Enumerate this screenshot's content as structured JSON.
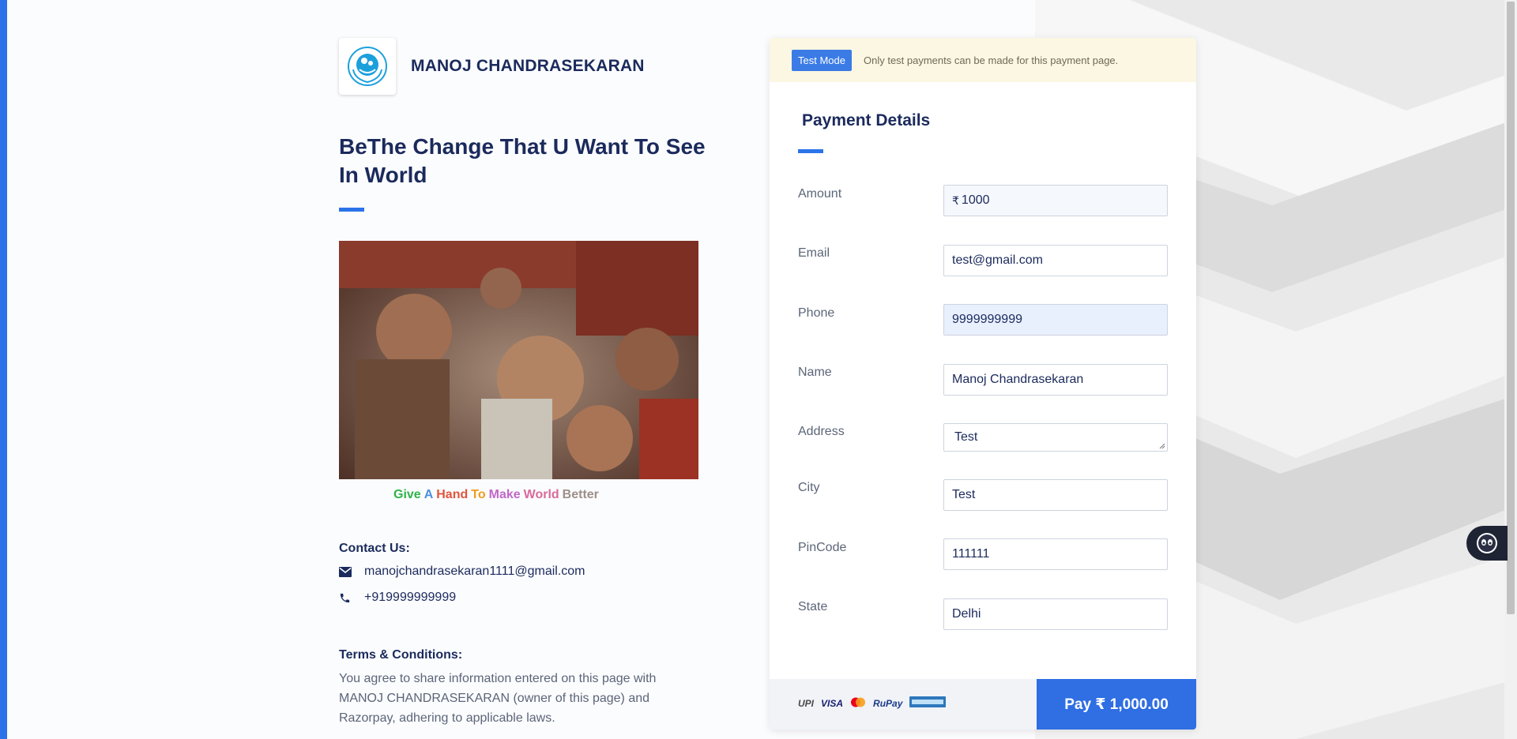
{
  "merchant": {
    "name": "MANOJ CHANDRASEKARAN"
  },
  "headline": "BeThe Change That U Want To See In World",
  "caption": [
    {
      "text": "Give",
      "color": "#2fb34a"
    },
    {
      "text": "A",
      "color": "#4a8fe0"
    },
    {
      "text": "Hand",
      "color": "#e2553c"
    },
    {
      "text": "To",
      "color": "#f29c1f"
    },
    {
      "text": "Make",
      "color": "#c067c8"
    },
    {
      "text": "World",
      "color": "#d96a9a"
    },
    {
      "text": "Better",
      "color": "#9e8f8a"
    }
  ],
  "contact": {
    "title": "Contact Us:",
    "email": "manojchandrasekaran1111@gmail.com",
    "phone": "+919999999999"
  },
  "terms": {
    "title": "Terms & Conditions:",
    "text": "You agree to share information entered on this page with MANOJ CHANDRASEKARAN (owner of this page) and Razorpay, adhering to applicable laws."
  },
  "banner": {
    "badge": "Test Mode",
    "message": "Only test payments can be made for this payment page."
  },
  "form": {
    "title": "Payment Details",
    "currency_symbol": "₹",
    "fields": {
      "amount": {
        "label": "Amount",
        "value": "1000"
      },
      "email": {
        "label": "Email",
        "value": "test@gmail.com"
      },
      "phone": {
        "label": "Phone",
        "value": "9999999999"
      },
      "name": {
        "label": "Name",
        "value": "Manoj Chandrasekaran"
      },
      "address": {
        "label": "Address",
        "value": "Test"
      },
      "city": {
        "label": "City",
        "value": "Test"
      },
      "pincode": {
        "label": "PinCode",
        "value": "111111"
      },
      "state": {
        "label": "State",
        "value": "Delhi"
      }
    }
  },
  "payment_methods": {
    "upi": "UPI",
    "visa": "VISA",
    "rupay": "RuPay"
  },
  "pay_button": "Pay ₹ 1,000.00",
  "colors": {
    "accent": "#2b73e8",
    "pay_button": "#2f6ee3",
    "title": "#1b2a5c",
    "banner_bg": "#fcf7e2"
  },
  "icons": [
    "unicef-logo-icon",
    "mail-icon",
    "phone-icon",
    "mastercard-icon",
    "amex-icon",
    "chat-bot-icon"
  ]
}
